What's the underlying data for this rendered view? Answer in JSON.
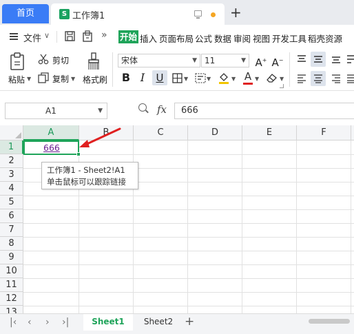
{
  "tabs": {
    "home": "首页",
    "doc_title": "工作簿1",
    "doc_icon_letter": "S",
    "new_tab": "+"
  },
  "menu": {
    "file": "文件",
    "more": "»",
    "items": [
      "开始",
      "插入",
      "页面布局",
      "公式",
      "数据",
      "审阅",
      "视图",
      "开发工具",
      "稻壳资源"
    ]
  },
  "ribbon": {
    "paste": "粘贴",
    "cut": "剪切",
    "copy": "复制",
    "format_painter": "格式刷",
    "font_name": "宋体",
    "font_size": "11",
    "bold": "B",
    "italic": "I",
    "underline": "U",
    "font_color_glyph": "A"
  },
  "formula": {
    "name_box": "A1",
    "fx": "fx",
    "value": "666"
  },
  "grid": {
    "columns": [
      "A",
      "B",
      "C",
      "D",
      "E",
      "F"
    ],
    "rows": [
      "1",
      "2",
      "3",
      "4",
      "5",
      "6",
      "7",
      "8",
      "9",
      "10",
      "11",
      "12",
      "13"
    ],
    "a1_value": "666",
    "tooltip_line1": "工作簿1 - Sheet2!A1",
    "tooltip_line2": "单击鼠标可以跟踪链接"
  },
  "sheets": {
    "tabs": [
      "Sheet1",
      "Sheet2"
    ],
    "active": "Sheet1",
    "add": "+"
  },
  "colors": {
    "accent_green": "#1fa45a",
    "home_tab_blue": "#3a7cf6",
    "hyperlink_purple": "#6b1f93",
    "arrow_red": "#e02020"
  }
}
